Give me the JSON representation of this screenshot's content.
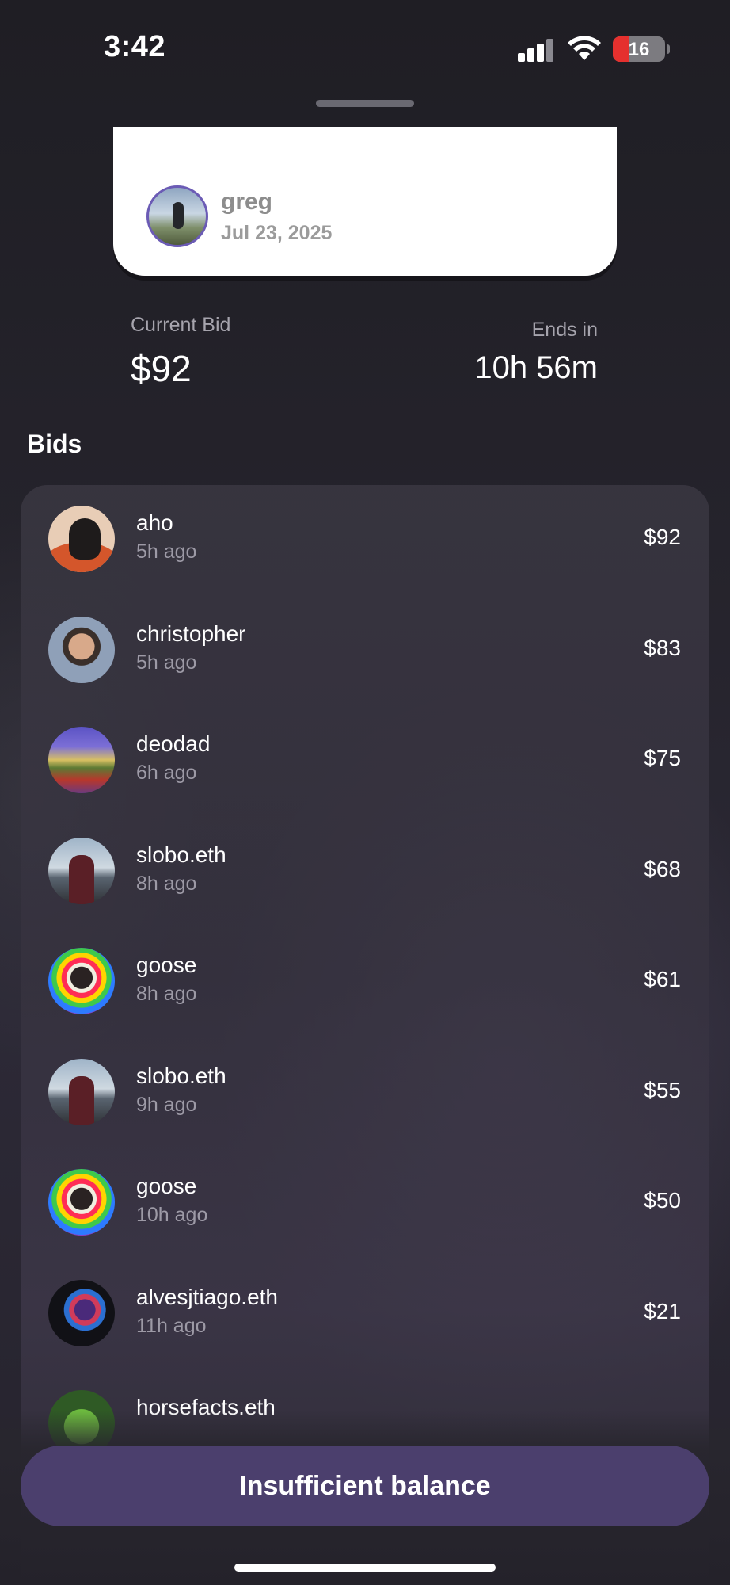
{
  "status_bar": {
    "time": "3:42",
    "battery": "16"
  },
  "card": {
    "name": "greg",
    "date": "Jul 23, 2025"
  },
  "summary": {
    "current_bid_label": "Current Bid",
    "current_bid_value": "$92",
    "ends_label": "Ends in",
    "ends_value": "10h 56m"
  },
  "bids_heading": "Bids",
  "bids": [
    {
      "name": "aho",
      "time": "5h ago",
      "amount": "$92"
    },
    {
      "name": "christopher",
      "time": "5h ago",
      "amount": "$83"
    },
    {
      "name": "deodad",
      "time": "6h ago",
      "amount": "$75"
    },
    {
      "name": "slobo.eth",
      "time": "8h ago",
      "amount": "$68"
    },
    {
      "name": "goose",
      "time": "8h ago",
      "amount": "$61"
    },
    {
      "name": "slobo.eth",
      "time": "9h ago",
      "amount": "$55"
    },
    {
      "name": "goose",
      "time": "10h ago",
      "amount": "$50"
    },
    {
      "name": "alvesjtiago.eth",
      "time": "11h ago",
      "amount": "$21"
    },
    {
      "name": "horsefacts.eth",
      "time": "",
      "amount": ""
    }
  ],
  "cta": {
    "label": "Insufficient balance"
  }
}
